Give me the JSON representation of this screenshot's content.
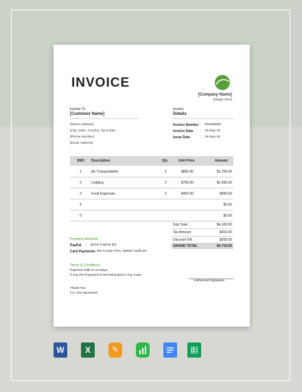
{
  "invoice": {
    "title": "INVOICE",
    "company_name": "[Company Name]",
    "slogan": "[Slogan Here]",
    "invoice_to_label": "Invoice To",
    "customer_name": "[Customer Name]",
    "address": [
      "[Street Address]",
      "[City, State, Country, Zip Code]",
      "[Phone Number]",
      "[Email Address]"
    ],
    "details_label_small": "Invoice",
    "details_label": "Details",
    "details": [
      {
        "label": "Invoice Number",
        "sep": ":",
        "value": "#55668899"
      },
      {
        "label": "Invoice Date",
        "sep": ":",
        "value": "20-May-25"
      },
      {
        "label": "Issue Date",
        "sep": ":",
        "value": "26-May-25"
      }
    ],
    "table": {
      "headers": [
        "SNO",
        "Description",
        "Qty",
        "Unit Price",
        "Amount"
      ],
      "rows": [
        {
          "sno": "1",
          "desc": "Air Transportation",
          "qty": "2",
          "unit": "$850.00",
          "amount": "$1,700.00"
        },
        {
          "sno": "2",
          "desc": "Lodging",
          "qty": "2",
          "unit": "$750.00",
          "amount": "$1,500.00"
        },
        {
          "sno": "3",
          "desc": "Food Expenses",
          "qty": "2",
          "unit": "$450.00",
          "amount": "$900.00"
        },
        {
          "sno": "4",
          "desc": "",
          "qty": "",
          "unit": "",
          "amount": "$0.00"
        },
        {
          "sno": "5",
          "desc": "",
          "qty": "",
          "unit": "",
          "amount": "$0.00"
        }
      ]
    },
    "summary": [
      {
        "label": "Sub Total",
        "value": "$4,100.00"
      },
      {
        "label": "Tax Amount",
        "value": "$410.00"
      },
      {
        "label": "Discount 5%",
        "value": "$205.00"
      },
      {
        "label": "GRAND TOTAL",
        "value": "$4,715.00"
      }
    ],
    "payment_methods_label": "Payment Methods:",
    "paypal_label": "PayPal",
    "paypal_value": "[Enter PayPal ID]",
    "card_label": "Card Payments:",
    "card_value": "We Accept VISA, Master cards.etc",
    "terms_label": "Terms & Conditions",
    "terms_lines": [
      "Payment With In 15 Days",
      "If Any Pre Payment is Not Refunded In Any Case"
    ],
    "signature_label": "Authorized Signature",
    "thanks_lines": [
      "Thank You",
      "For Your Business!"
    ]
  },
  "apps": [
    {
      "name": "word-icon",
      "letter": "W",
      "color": "#2b579a"
    },
    {
      "name": "excel-icon",
      "letter": "X",
      "color": "#217346"
    },
    {
      "name": "pages-icon",
      "letter": "✎",
      "color": "#f19a1f"
    },
    {
      "name": "numbers-icon",
      "letter": "▮",
      "color": "#2fb84a"
    },
    {
      "name": "google-docs-icon",
      "letter": "≡",
      "color": "#4285f4"
    },
    {
      "name": "google-sheets-icon",
      "letter": "▦",
      "color": "#0f9d58"
    }
  ]
}
